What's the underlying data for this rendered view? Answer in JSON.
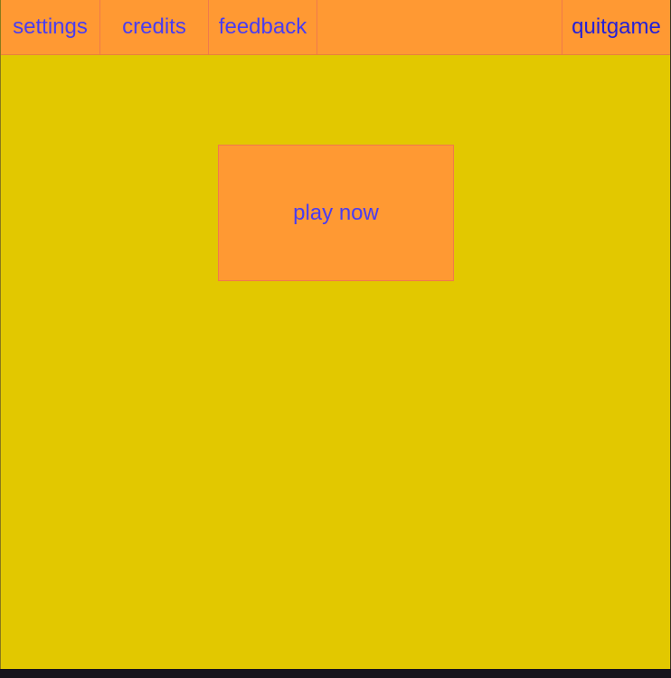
{
  "menu": {
    "settings_label": "settings",
    "credits_label": "credits",
    "feedback_label": "feedback",
    "quit_label": "quitgame"
  },
  "main": {
    "play_label": "play now"
  },
  "colors": {
    "background": "#e2c800",
    "button_fill": "#ff9933",
    "button_text": "#4a3df0"
  }
}
